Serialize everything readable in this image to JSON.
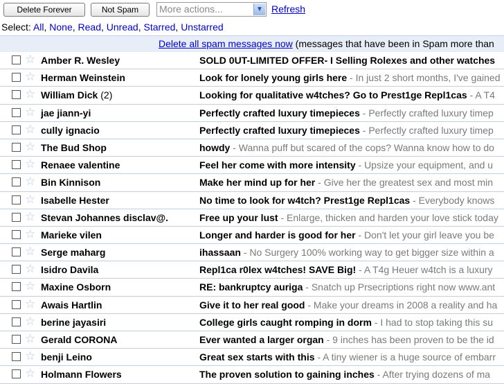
{
  "toolbar": {
    "delete_forever": "Delete Forever",
    "not_spam": "Not Spam",
    "more_actions": "More actions...",
    "refresh": "Refresh"
  },
  "select_bar": {
    "label": "Select:",
    "options": [
      "All",
      "None",
      "Read",
      "Unread",
      "Starred",
      "Unstarred"
    ]
  },
  "notice": {
    "link": "Delete all spam messages now",
    "text": " (messages that have been in Spam more than"
  },
  "messages": [
    {
      "sender": "Amber R. Wesley",
      "count": "",
      "subject": "SOLD 0UT-LIMITED OFFER- I Selling Rolexes and other watches",
      "snippet": ""
    },
    {
      "sender": "Herman Weinstein",
      "count": "",
      "subject": "Look for lonely young girls here",
      "snippet": " - In just 2 short months, I've gained"
    },
    {
      "sender": "William Dick",
      "count": "(2)",
      "subject": "Looking for qualitative w4tches? Go to Prest1ge Repl1cas",
      "snippet": " - A T4"
    },
    {
      "sender": "jae jiann-yi",
      "count": "",
      "subject": "Perfectly crafted luxury timepieces",
      "snippet": " - Perfectly crafted luxury timep"
    },
    {
      "sender": "cully ignacio",
      "count": "",
      "subject": "Perfectly crafted luxury timepieces",
      "snippet": " - Perfectly crafted luxury timep"
    },
    {
      "sender": "The Bud Shop",
      "count": "",
      "subject": "howdy",
      "snippet": " - Wanna puff but scared of the cops? Wanna know how to do"
    },
    {
      "sender": "Renaee valentine",
      "count": "",
      "subject": "Feel her come with more intensity",
      "snippet": " - Upsize your equipment, and u"
    },
    {
      "sender": "Bin Kinnison",
      "count": "",
      "subject": "Make her mind up for her",
      "snippet": " - Give her the greatest sex and most min"
    },
    {
      "sender": "Isabelle Hester",
      "count": "",
      "subject": "No time to look for w4tch? Prest1ge Repl1cas",
      "snippet": " - Everybody knows"
    },
    {
      "sender": "Stevan Johannes disclav@.",
      "count": "",
      "subject": "Free up your lust",
      "snippet": " - Enlarge, thicken and harden your love stick today"
    },
    {
      "sender": "Marieke vilen",
      "count": "",
      "subject": "Longer and harder is good for her",
      "snippet": " - Don't let your girl leave you be"
    },
    {
      "sender": "Serge maharg",
      "count": "",
      "subject": "ihassaan",
      "snippet": " - No Surgery 100% working way to get bigger size within a"
    },
    {
      "sender": "Isidro Davila",
      "count": "",
      "subject": "Repl1ca r0lex w4tches! SAVE Big!",
      "snippet": " - A T4g Heuer w4tch is a luxury"
    },
    {
      "sender": "Maxine Osborn",
      "count": "",
      "subject": "RE: bankruptcy auriga",
      "snippet": " - Snatch up Prsecriptions right now www.ant"
    },
    {
      "sender": "Awais Hartlin",
      "count": "",
      "subject": "Give it to her real good",
      "snippet": " - Make your dreams in 2008 a reality and ha"
    },
    {
      "sender": "berine jayasiri",
      "count": "",
      "subject": "College girls caught romping in dorm",
      "snippet": " - I had to stop taking this su"
    },
    {
      "sender": "Gerald CORONA",
      "count": "",
      "subject": "Ever wanted a larger organ",
      "snippet": " - 9 inches has been proven to be the id"
    },
    {
      "sender": "benji Leino",
      "count": "",
      "subject": "Great sex starts with this",
      "snippet": " - A tiny wiener is a huge source of embarr"
    },
    {
      "sender": "Holmann Flowers",
      "count": "",
      "subject": "The proven solution to gaining inches",
      "snippet": " - After trying dozens of ma"
    }
  ]
}
